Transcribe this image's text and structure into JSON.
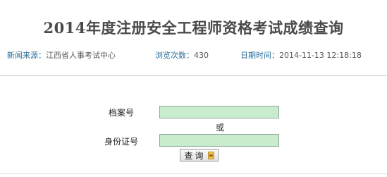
{
  "page": {
    "title": "2014年度注册安全工程师资格考试成绩查询"
  },
  "meta": {
    "source_label": "新闻来源：",
    "source_value": "江西省人事考试中心",
    "views_label": "浏览次数：",
    "views_value": "430",
    "datetime_label": "日期时间：",
    "datetime_value": "2014-11-13 12:18:18"
  },
  "form": {
    "archive_label": "档案号",
    "archive_value": "",
    "or_text": "或",
    "id_label": "身份证号",
    "id_value": "",
    "query_button_label": "查询"
  },
  "colors": {
    "input_background": "#c9ecce",
    "meta_label": "#2a6e9c",
    "title": "#4a4a4a"
  },
  "icons": {
    "query_button_icon": "query-icon"
  }
}
